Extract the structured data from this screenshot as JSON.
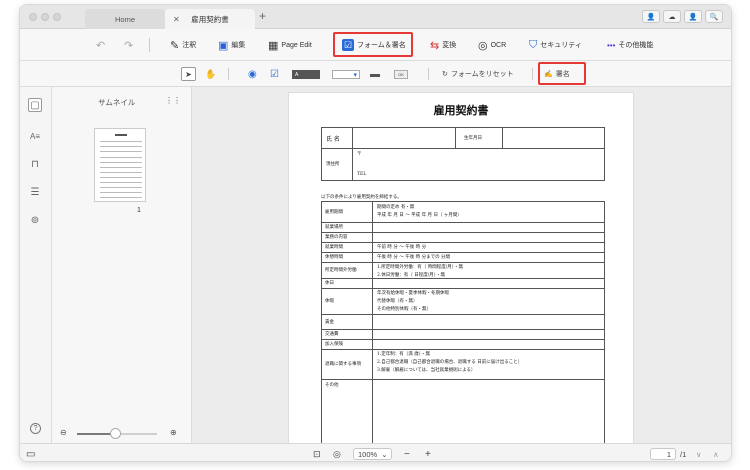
{
  "tabs": [
    {
      "label": "Home"
    },
    {
      "label": "雇用契約書"
    }
  ],
  "tab_close": "✕",
  "tab_plus": "+",
  "window_buttons": [
    "👤",
    "☁",
    "👤",
    "🔍"
  ],
  "toolbar": {
    "undo": "↶",
    "redo": "↷",
    "items": [
      {
        "label": "注釈",
        "icon": "pen-icon",
        "glyph": "✎"
      },
      {
        "label": "編集",
        "icon": "edit-icon",
        "glyph": "▣"
      },
      {
        "label": "Page Edit",
        "icon": "page-edit-icon",
        "glyph": "▦"
      },
      {
        "label": "フォーム＆署名",
        "icon": "form-sign-icon",
        "glyph": "☑"
      },
      {
        "label": "変換",
        "icon": "convert-icon",
        "glyph": "⇆"
      },
      {
        "label": "OCR",
        "icon": "ocr-icon",
        "glyph": "◎"
      },
      {
        "label": "セキュリティ",
        "icon": "shield-icon",
        "glyph": "⛉"
      },
      {
        "label": "その他機能",
        "icon": "more-icon",
        "glyph": "•••"
      }
    ]
  },
  "form_toolbar": {
    "select": "➤",
    "hand": "✋",
    "radio": "◉",
    "checkbox": "☑",
    "textfield": "A",
    "dropdown": "▾",
    "listbox": "▬",
    "button_label": "OK",
    "reset_icon": "↻",
    "reset_label": "フォームをリセット",
    "sign_icon": "✍",
    "sign_label": "署名"
  },
  "left_icons": [
    {
      "name": "thumbnail-icon",
      "glyph": "▢"
    },
    {
      "name": "text-size-icon",
      "glyph": "A≡"
    },
    {
      "name": "bookmark-icon",
      "glyph": "⊓"
    },
    {
      "name": "list-icon",
      "glyph": "☰"
    },
    {
      "name": "attachment-icon",
      "glyph": "⊚"
    },
    {
      "name": "help-icon",
      "glyph": "?"
    }
  ],
  "thumbnail_panel": {
    "title": "サムネイル",
    "grid_icon": "⋮⋮",
    "page_number": "1"
  },
  "document": {
    "title": "雇用契約書",
    "name_label": "氏  名",
    "birth_label": "生年月日",
    "address_label": "現住所",
    "postal": "〒",
    "tel": "TEL",
    "intro": "以下の条件により雇用契約を締結する。",
    "rows": [
      {
        "label": "雇用期間",
        "lines": [
          "期間の定め  有・無",
          "平成     年    月     日  〜  平成     年     月     日（   ヶ月間）"
        ]
      },
      {
        "label": "就業場所",
        "lines": [
          ""
        ]
      },
      {
        "label": "業務の内容",
        "lines": [
          ""
        ]
      },
      {
        "label": "就業時間",
        "lines": [
          "午前      時      分  〜  午後      時      分"
        ]
      },
      {
        "label": "休憩時間",
        "lines": [
          "午後      時      分  〜  午後      時      分までの       分間"
        ]
      },
      {
        "label": "所定時間外労働",
        "lines": [
          "1.所定時間外労働：有（      時間程度/月）・無",
          "2.休日労働：有（      日程度/月）・無"
        ]
      },
      {
        "label": "休日",
        "lines": [
          ""
        ]
      },
      {
        "label": "休暇",
        "lines": [
          "年次有給休暇・夏季休暇・冬期休暇",
          "代替休暇（有・無）",
          "その他特別休暇（有・無）"
        ]
      },
      {
        "label": "賃金",
        "lines": [
          ""
        ]
      },
      {
        "label": "交通費",
        "lines": [
          ""
        ]
      },
      {
        "label": "加入保険",
        "lines": [
          ""
        ]
      },
      {
        "label": "退職に関する事項",
        "lines": [
          "1.定年制：有（満      歳）・無",
          "2.自己都合退職（自己都合退職の場合、退職する      日前に届け出ること）",
          "3.解雇（解雇については、当社就業規則による）"
        ]
      },
      {
        "label": "その他",
        "lines": [
          ""
        ]
      }
    ]
  },
  "statusbar": {
    "zoom_out": "⊖",
    "zoom_in": "⊕",
    "fit_icon": "⊡",
    "eye_icon": "◎",
    "zoom_value": "100%",
    "zoom_caret": "⌄",
    "minus": "−",
    "plus": "+",
    "page_current": "1",
    "page_total": "/1",
    "prev": "∨",
    "next": "∧",
    "panel_icon": "▭"
  }
}
